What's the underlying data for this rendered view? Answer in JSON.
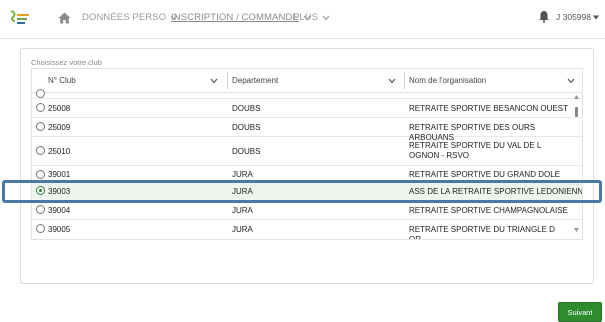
{
  "nav": {
    "items": [
      {
        "label": "DONNÉES PERSO",
        "active": false
      },
      {
        "label": "INSCRIPTION / COMMANDE",
        "active": true
      },
      {
        "label": "PLUS",
        "active": false
      }
    ],
    "user_label": "J 305998"
  },
  "panel": {
    "label": "Choisissez votre club"
  },
  "table": {
    "columns": [
      "N° Club",
      "Departement",
      "Nom de l'organisation"
    ],
    "rows": [
      {
        "club": "25008",
        "departement": "DOUBS",
        "organisation": "RETRAITE SPORTIVE BESANCON OUEST",
        "selected": false
      },
      {
        "club": "25009",
        "departement": "DOUBS",
        "organisation": "RETRAITE SPORTIVE DES OURS ARBOUANS",
        "selected": false
      },
      {
        "club": "25010",
        "departement": "DOUBS",
        "organisation": "RETRAITE SPORTIVE DU VAL DE L OGNON - RSVO",
        "selected": false
      },
      {
        "club": "39001",
        "departement": "JURA",
        "organisation": "RETRAITE SPORTIVE DU GRAND DOLE",
        "selected": false
      },
      {
        "club": "39003",
        "departement": "JURA",
        "organisation": "ASS DE LA RETRAITE SPORTIVE LEDONIENNE",
        "selected": true
      },
      {
        "club": "39004",
        "departement": "JURA",
        "organisation": "RETRAITE SPORTIVE CHAMPAGNOLAISE",
        "selected": false
      },
      {
        "club": "39005",
        "departement": "JURA",
        "organisation": "RETRAITE SPORTIVE DU TRIANGLE D OR",
        "selected": false
      }
    ]
  },
  "actions": {
    "next_label": "Suivant"
  },
  "colors": {
    "accent": "#2e8b2e",
    "highlight": "#4a79a8"
  }
}
